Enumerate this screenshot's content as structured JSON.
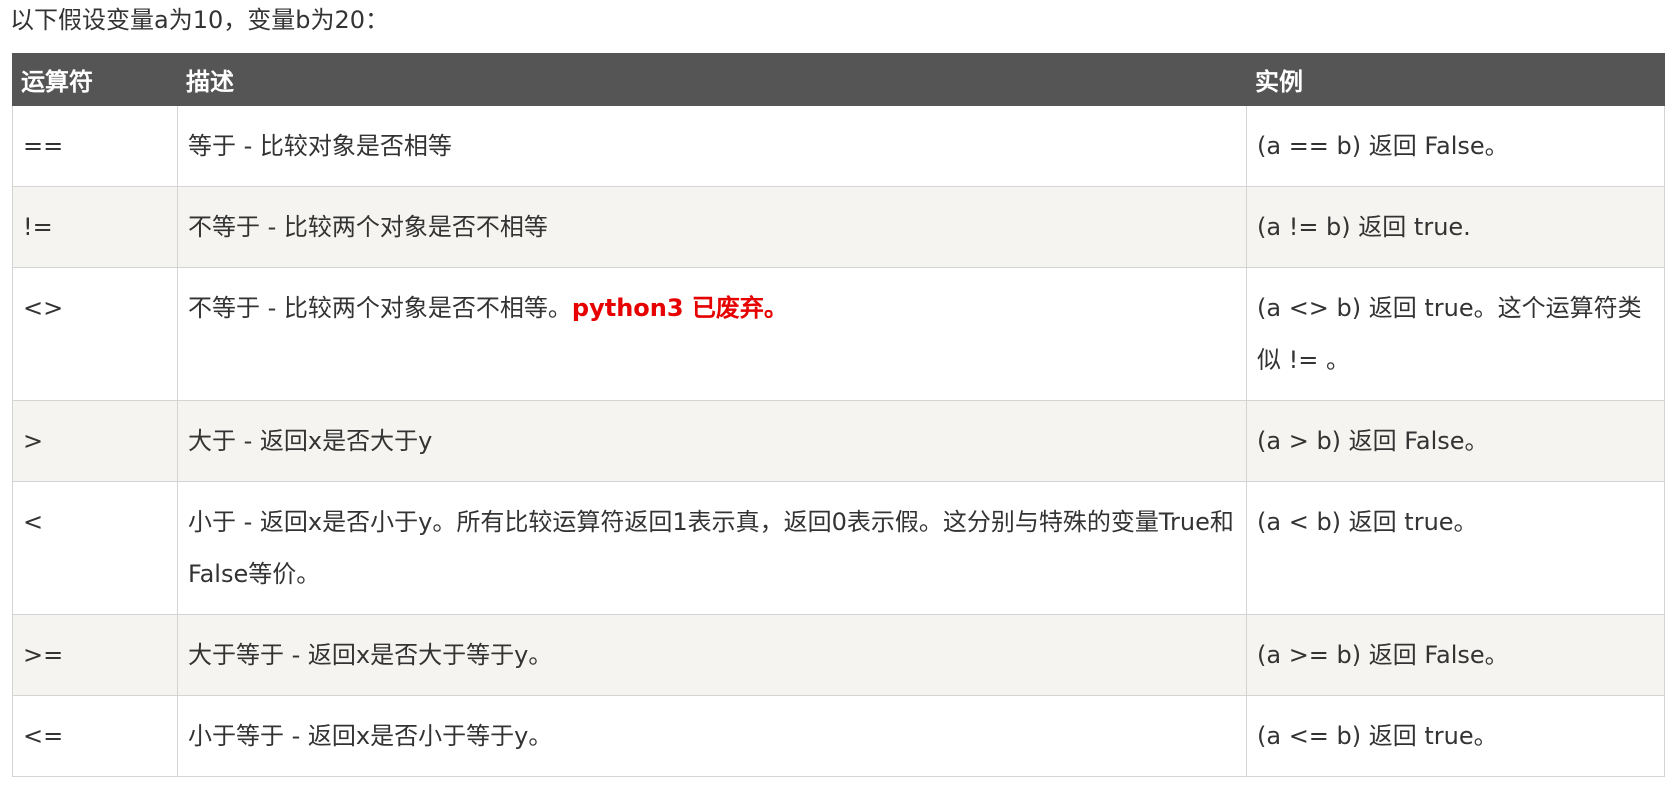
{
  "intro": "以下假设变量a为10，变量b为20：",
  "table": {
    "headers": {
      "op": "运算符",
      "desc": "描述",
      "example": "实例"
    },
    "rows": [
      {
        "op": "==",
        "desc": "等于 - 比较对象是否相等",
        "note": "",
        "example": "(a == b) 返回 False。"
      },
      {
        "op": "!=",
        "desc": "不等于 - 比较两个对象是否不相等",
        "note": "",
        "example": "(a != b) 返回 true."
      },
      {
        "op": "<>",
        "desc": "不等于 - 比较两个对象是否不相等。",
        "note": "python3 已废弃。",
        "example": "(a <> b) 返回 true。这个运算符类似 != 。"
      },
      {
        "op": ">",
        "desc": "大于 - 返回x是否大于y",
        "note": "",
        "example": "(a > b) 返回 False。"
      },
      {
        "op": "<",
        "desc": "小于 - 返回x是否小于y。所有比较运算符返回1表示真，返回0表示假。这分别与特殊的变量True和False等价。",
        "note": "",
        "example": "(a < b) 返回 true。"
      },
      {
        "op": ">=",
        "desc": "大于等于 - 返回x是否大于等于y。",
        "note": "",
        "example": "(a >= b) 返回 False。"
      },
      {
        "op": "<=",
        "desc": "小于等于 - 返回x是否小于等于y。",
        "note": "",
        "example": "(a <= b) 返回 true。"
      }
    ]
  },
  "colors": {
    "header_bg": "#555555",
    "header_text": "#ffffff",
    "row_alt_bg": "#f6f4f0",
    "warning": "#e60000",
    "border": "#d4d4d4"
  }
}
